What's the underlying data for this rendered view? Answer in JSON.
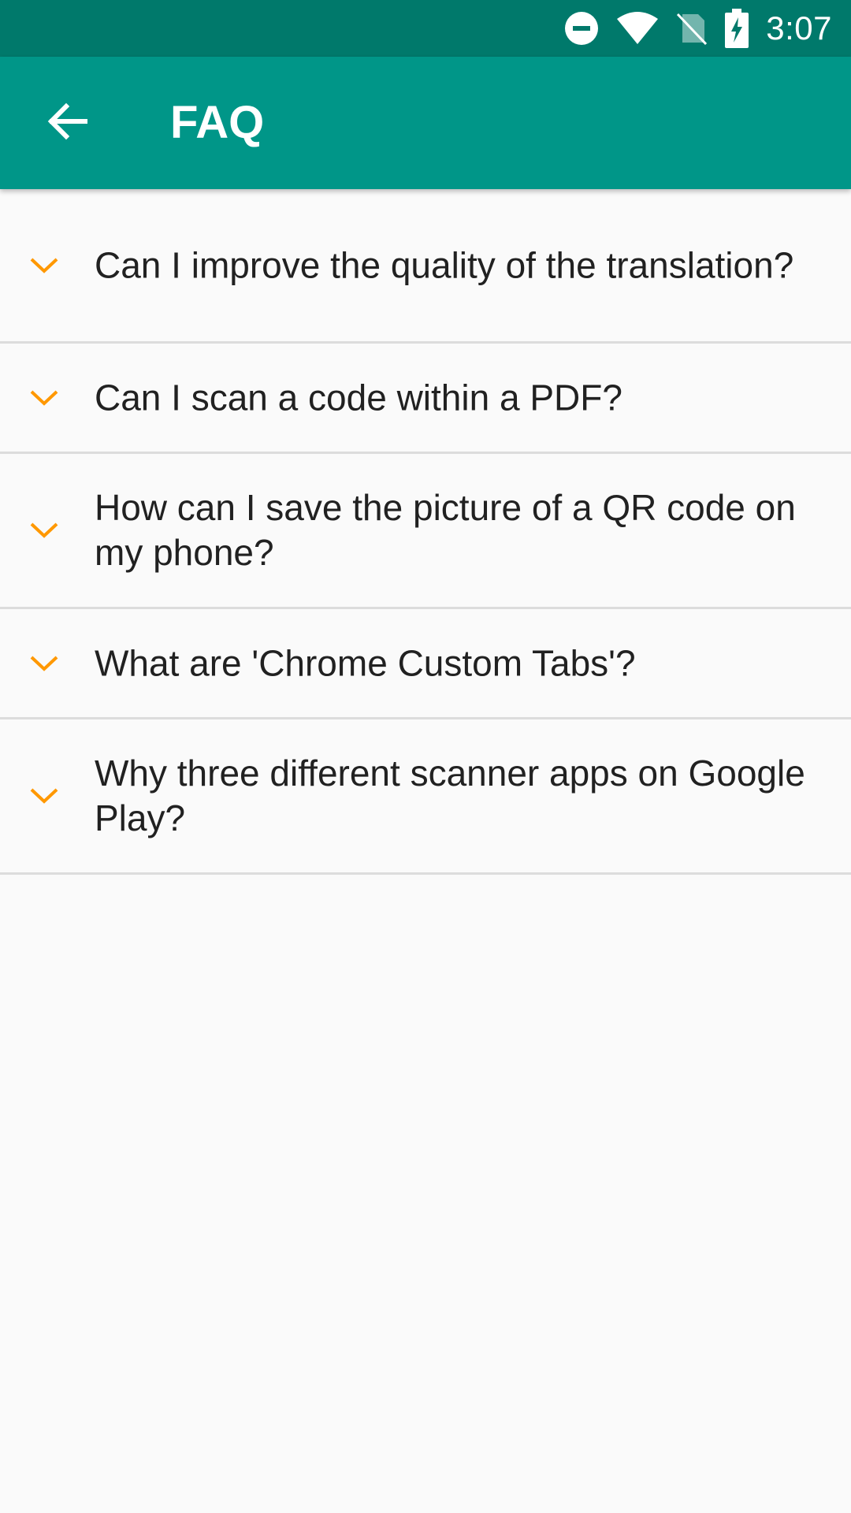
{
  "status_bar": {
    "time": "3:07",
    "icons": [
      "do-not-disturb-icon",
      "wifi-icon",
      "no-sim-icon",
      "battery-charging-icon"
    ]
  },
  "app_bar": {
    "title": "FAQ",
    "back_icon": "arrow-back-icon"
  },
  "faq": {
    "chevron_icon": "chevron-down-icon",
    "items": [
      {
        "question": "Can I improve the quality of the translation?"
      },
      {
        "question": "Can I scan a code within a PDF?"
      },
      {
        "question": "How can I save the picture of a QR code on my phone?"
      },
      {
        "question": "What are 'Chrome Custom Tabs'?"
      },
      {
        "question": "Why three different scanner apps on Google Play?"
      }
    ]
  },
  "colors": {
    "status_bar": "#00796b",
    "app_bar": "#009688",
    "accent": "#ff9800",
    "background": "#fafafa",
    "divider": "#dcdcdc",
    "text": "#212121"
  }
}
